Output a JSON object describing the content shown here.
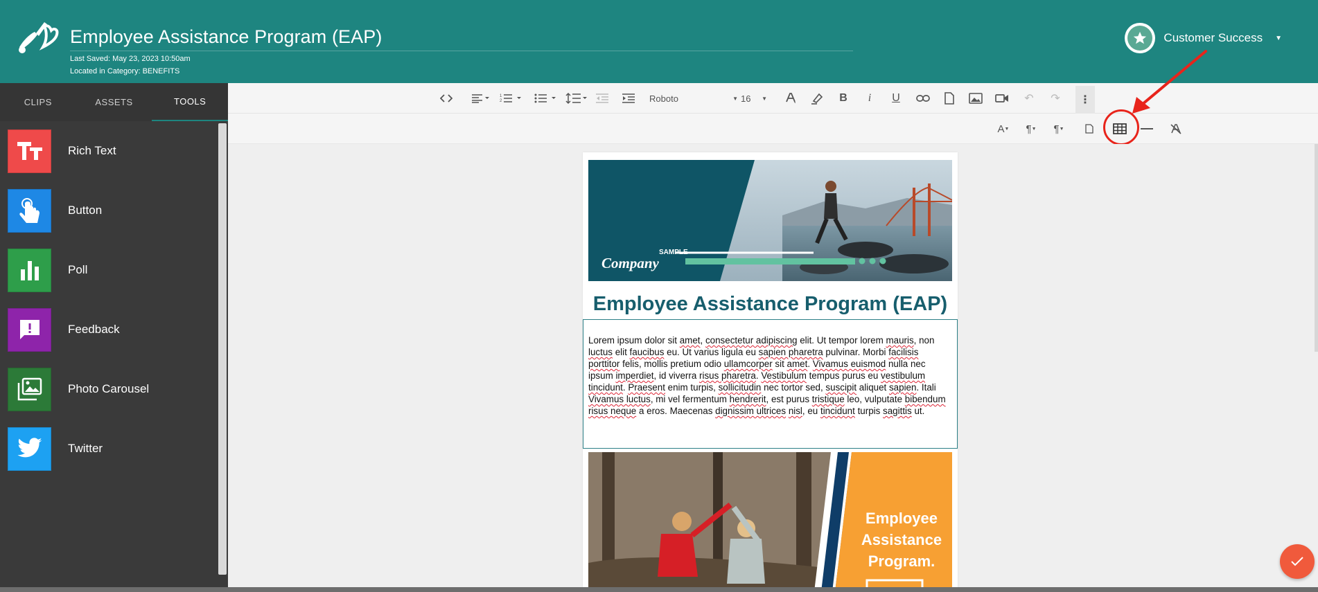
{
  "header": {
    "title": "Employee Assistance Program (EAP)",
    "last_saved": "Last Saved: May 23, 2023 10:50am",
    "category": "Located in Category: BENEFITS",
    "user_name": "Customer Success",
    "accent_color": "#1e8580"
  },
  "sidebar": {
    "tabs": [
      {
        "label": "CLIPS",
        "active": false
      },
      {
        "label": "ASSETS",
        "active": false
      },
      {
        "label": "TOOLS",
        "active": true
      }
    ],
    "tools": [
      {
        "label": "Rich Text",
        "icon": "text-format-icon",
        "color": "#ef4a4a"
      },
      {
        "label": "Button",
        "icon": "pointer-hand-icon",
        "color": "#1e88e5"
      },
      {
        "label": "Poll",
        "icon": "bar-chart-icon",
        "color": "#2e9e4a"
      },
      {
        "label": "Feedback",
        "icon": "feedback-icon",
        "color": "#8e24aa"
      },
      {
        "label": "Photo Carousel",
        "icon": "photo-library-icon",
        "color": "#2c7a38"
      },
      {
        "label": "Twitter",
        "icon": "twitter-bird-icon",
        "color": "#1da1f2"
      }
    ]
  },
  "toolbar": {
    "font_family": "Roboto",
    "font_size": "16"
  },
  "document": {
    "banner_logo_small": "SAMPLE",
    "banner_logo": "Company",
    "title": "Employee Assistance Program (EAP)",
    "body_segments": [
      {
        "t": "Lorem ipsum dolor sit ",
        "s": false
      },
      {
        "t": "amet",
        "s": true
      },
      {
        "t": ", ",
        "s": false
      },
      {
        "t": "consectetur adipiscing",
        "s": true
      },
      {
        "t": " elit. Ut tempor lorem ",
        "s": false
      },
      {
        "t": "mauris",
        "s": true
      },
      {
        "t": ", non ",
        "s": false
      },
      {
        "t": "luctus",
        "s": true
      },
      {
        "t": " elit ",
        "s": false
      },
      {
        "t": "faucibus",
        "s": true
      },
      {
        "t": " eu. Ut varius ligula eu ",
        "s": false
      },
      {
        "t": "sapien pharetra",
        "s": true
      },
      {
        "t": " pulvinar. Morbi ",
        "s": false
      },
      {
        "t": "facilisis porttitor",
        "s": true
      },
      {
        "t": " felis, mollis pretium odio ",
        "s": false
      },
      {
        "t": "ullamcorper",
        "s": true
      },
      {
        "t": " sit ",
        "s": false
      },
      {
        "t": "amet",
        "s": true
      },
      {
        "t": ". ",
        "s": false
      },
      {
        "t": "Vivamus euismod",
        "s": true
      },
      {
        "t": " nulla nec ipsum ",
        "s": false
      },
      {
        "t": "imperdiet",
        "s": true
      },
      {
        "t": ", id viverra ",
        "s": false
      },
      {
        "t": "risus pharetra",
        "s": true
      },
      {
        "t": ". ",
        "s": false
      },
      {
        "t": "Vestibulum",
        "s": true
      },
      {
        "t": " tempus purus eu ",
        "s": false
      },
      {
        "t": "vestibulum tincidunt",
        "s": true
      },
      {
        "t": ". ",
        "s": false
      },
      {
        "t": "Praesent",
        "s": true
      },
      {
        "t": " enim turpis, ",
        "s": false
      },
      {
        "t": "sollicitudin",
        "s": true
      },
      {
        "t": " nec tortor sed, ",
        "s": false
      },
      {
        "t": "suscipit",
        "s": true
      },
      {
        "t": " aliquet ",
        "s": false
      },
      {
        "t": "sapien",
        "s": true
      },
      {
        "t": ".   Itali ",
        "s": false
      },
      {
        "t": "Vivamus luctus",
        "s": true
      },
      {
        "t": ", mi vel fermentum ",
        "s": false
      },
      {
        "t": "hendrerit",
        "s": true
      },
      {
        "t": ", est purus ",
        "s": false
      },
      {
        "t": "tristique",
        "s": true
      },
      {
        "t": " leo, vulputate ",
        "s": false
      },
      {
        "t": "bibendum risus neque",
        "s": true
      },
      {
        "t": " a eros. Maecenas ",
        "s": false
      },
      {
        "t": "dignissim ultrices",
        "s": true
      },
      {
        "t": " ",
        "s": false
      },
      {
        "t": "nisl",
        "s": true
      },
      {
        "t": ", eu ",
        "s": false
      },
      {
        "t": "tincidunt",
        "s": true
      },
      {
        "t": " turpis ",
        "s": false
      },
      {
        "t": "sagittis",
        "s": true
      },
      {
        "t": " ut.",
        "s": false
      }
    ],
    "second_image_text": "Employee Assistance Program."
  }
}
